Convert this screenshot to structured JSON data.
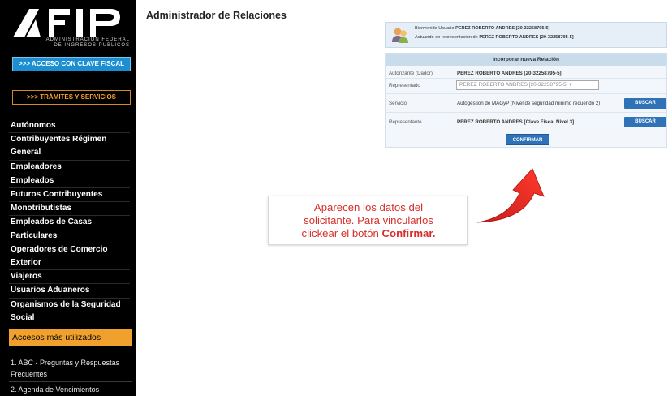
{
  "sidebar": {
    "logo_subtitle_1": "ADMINISTRACION FEDERAL",
    "logo_subtitle_2": "DE INGRESOS PUBLICOS",
    "btn_clave": ">>> ACCESO CON CLAVE FISCAL",
    "btn_tramites": ">>> TRÁMITES Y SERVICIOS",
    "nav_items": [
      "Autónomos",
      "Contribuyentes Régimen",
      "General",
      "Empleadores",
      "Empleados",
      "Futuros Contribuyentes",
      "Monotributistas",
      "Empleados de Casas",
      "Particulares",
      "Operadores de Comercio",
      "Exterior",
      "Viajeros",
      "Usuarios Aduaneros",
      "Organismos de la Seguridad",
      "Social"
    ],
    "accesos_title": "Accesos más utilizados",
    "accesos": [
      "1. ABC - Preguntas y Respuestas",
      "Frecuentes",
      "2. Agenda de Vencimientos"
    ]
  },
  "main": {
    "title": "Administrador de Relaciones",
    "welcome": {
      "line1_prefix": "Bienvenido Usuario ",
      "line1_bold": "PEREZ ROBERTO ANDRES [20-32258795-5]",
      "line2_prefix": "Actuando en representación de ",
      "line2_bold": "PEREZ ROBERTO ANDRES [20-32258795-5]"
    },
    "form": {
      "header": "Incorporar nueva Relación",
      "autorizante_label": "Autorizante (Dador)",
      "autorizante_value": "PEREZ ROBERTO ANDRES [20-32258795-5]",
      "representado_label": "Representado",
      "representado_value": "PEREZ ROBERTO ANDRES [20-32258795-5]",
      "servicio_label": "Servicio",
      "servicio_value": "Autogestion de MAGyP (Nivel de seguridad mínimo requerido 2)",
      "representante_label": "Representante",
      "representante_value": "PEREZ ROBERTO ANDRES [Clave Fiscal Nivel 3]",
      "buscar_label": "BUSCAR",
      "confirmar_label": "CONFIRMAR"
    },
    "callout": {
      "line1": "Aparecen los datos del",
      "line2": "solicitante. Para vincularlos",
      "line3_prefix": "clickear el botón ",
      "line3_bold": "Confirmar."
    }
  },
  "colors": {
    "sidebar_bg": "#000000",
    "accent_blue": "#1b8fd2",
    "accent_orange": "#f0a02c",
    "button_blue": "#2f72b8",
    "callout_red": "#d6302c"
  }
}
